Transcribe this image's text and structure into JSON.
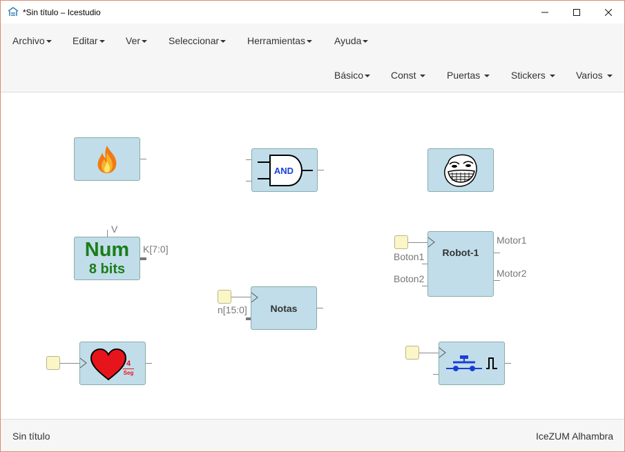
{
  "window": {
    "title": "*Sin título – Icestudio",
    "minimize_icon": "minimize-icon",
    "maximize_icon": "maximize-icon",
    "close_icon": "close-icon"
  },
  "menu": {
    "row1": [
      "Archivo",
      "Editar",
      "Ver",
      "Seleccionar",
      "Herramientas",
      "Ayuda"
    ],
    "row2": [
      "Básico",
      "Const",
      "Puertas",
      "Stickers",
      "Varios"
    ]
  },
  "blocks": {
    "fire": {
      "icon": "fire-icon"
    },
    "and_gate": {
      "text": "AND",
      "icon": "and-gate-icon"
    },
    "troll": {
      "icon": "trollface-icon"
    },
    "num": {
      "line1": "Num",
      "line2": "8 bits",
      "param": "V",
      "output": "K[7:0]"
    },
    "robot": {
      "name": "Robot-1",
      "in1": "Boton1",
      "in2": "Boton2",
      "out1": "Motor1",
      "out2": "Motor2"
    },
    "notas": {
      "name": "Notas",
      "input": "n[15:0]"
    },
    "heart": {
      "num": "4",
      "unit": "Seg",
      "icon": "heart-icon"
    },
    "button": {
      "icon": "pushbutton-icon"
    }
  },
  "status": {
    "left": "Sin título",
    "right": "IceZUM Alhambra"
  },
  "colors": {
    "block_fill": "#c1dde9",
    "pin_fill": "#fbf6c5",
    "num_text": "#1a7d1a",
    "and_text": "#1a3fd6",
    "heart_red": "#e8141b",
    "window_border": "#d98c6f"
  }
}
